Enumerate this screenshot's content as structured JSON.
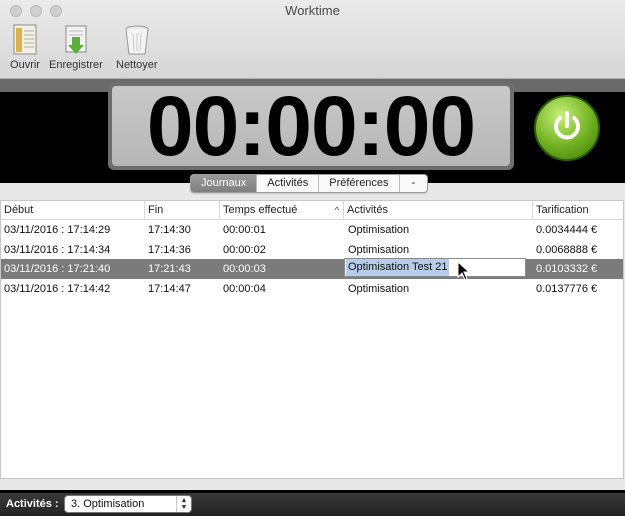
{
  "window": {
    "title": "Worktime"
  },
  "toolbar": {
    "open_label": "Ouvrir",
    "save_label": "Enregistrer",
    "clean_label": "Nettoyer"
  },
  "timer": {
    "value": "00:00:00"
  },
  "colors": {
    "power": "#6fb020",
    "selection": "#7b7b7b",
    "band": "#000000"
  },
  "tabs": [
    {
      "label": "Journaux",
      "active": true
    },
    {
      "label": "Activités",
      "active": false
    },
    {
      "label": "Préférences",
      "active": false
    },
    {
      "label": "-",
      "active": false
    }
  ],
  "table": {
    "columns": [
      "Début",
      "Fin",
      "Temps effectué",
      "Activités",
      "Tarification"
    ],
    "sort_indicator": "^",
    "rows": [
      {
        "debut": "03/11/2016 : 17:14:29",
        "fin": "17:14:30",
        "temps": "00:00:01",
        "activite": "Optimisation",
        "tarif": "0.0034444 €"
      },
      {
        "debut": "03/11/2016 : 17:14:34",
        "fin": "17:14:36",
        "temps": "00:00:02",
        "activite": "Optimisation",
        "tarif": "0.0068888 €"
      },
      {
        "debut": "03/11/2016 : 17:21:40",
        "fin": "17:21:43",
        "temps": "00:00:03",
        "activite": "Optimisation Test 21",
        "tarif": "0.0103332 €",
        "selected": true,
        "editing": true
      },
      {
        "debut": "03/11/2016 : 17:14:42",
        "fin": "17:14:47",
        "temps": "00:00:04",
        "activite": "Optimisation",
        "tarif": "0.0137776 €"
      }
    ]
  },
  "bottom": {
    "label": "Activités :",
    "select_value": "3. Optimisation"
  },
  "icons": [
    "document-icon",
    "save-download-icon",
    "trash-icon",
    "power-icon",
    "mouse-cursor-icon"
  ]
}
